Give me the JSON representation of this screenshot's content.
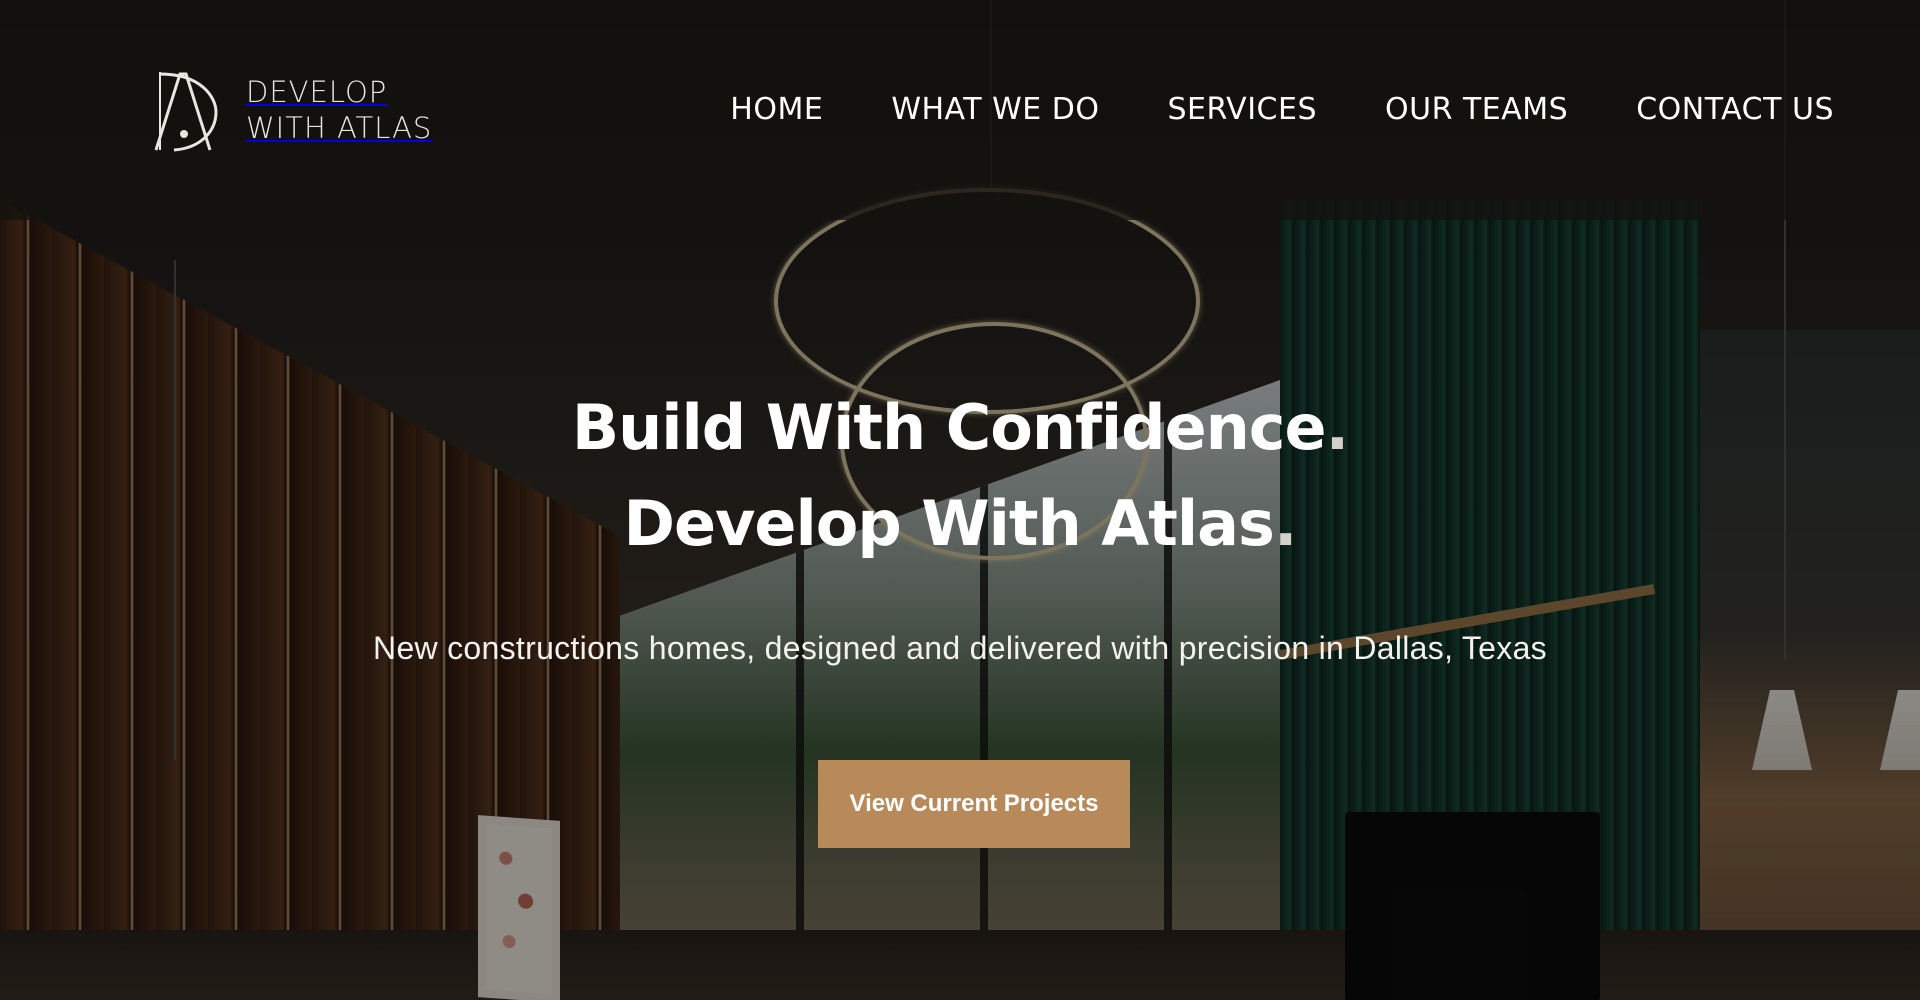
{
  "header": {
    "logo": {
      "line1": "DEVELOP",
      "line2": "WITH ATLAS"
    },
    "nav": [
      "HOME",
      "WHAT WE DO",
      "SERVICES",
      "OUR TEAMS",
      "CONTACT US"
    ]
  },
  "hero": {
    "headline_line1": "Build With Confidence",
    "headline_line2": "Develop With Atlas",
    "headline_period": ".",
    "subtitle": "New constructions homes, designed and delivered with precision in Dallas, Texas",
    "cta_label": "View Current Projects"
  },
  "colors": {
    "accent": "#b88a5a",
    "header_bg": "rgba(20,18,16,0.78)",
    "text": "#ffffff"
  },
  "icons": {
    "logo": "atlas-monogram-icon"
  }
}
